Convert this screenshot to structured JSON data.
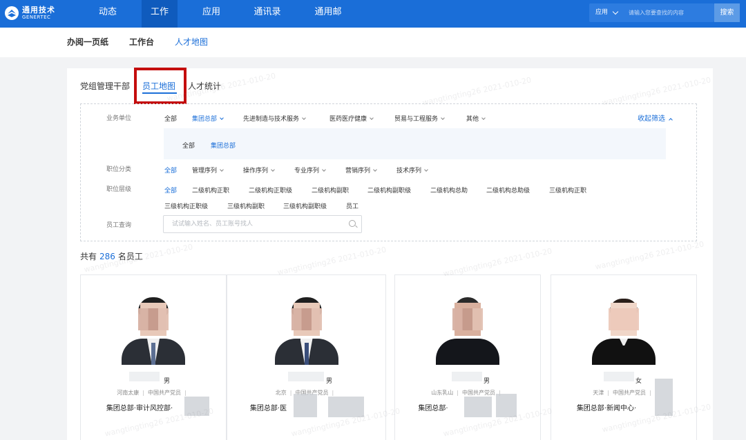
{
  "app": {
    "logo_cn": "通用技术",
    "logo_en": "GENERTEC"
  },
  "topnav": {
    "items": [
      "动态",
      "工作",
      "应用",
      "通讯录",
      "通用邮"
    ],
    "active": "工作",
    "search_scope": "应用",
    "search_placeholder": "请输入您要查找的内容",
    "search_button": "搜索"
  },
  "subnav": {
    "items": [
      "办阅一页纸",
      "工作台",
      "人才地图"
    ],
    "active": "人才地图"
  },
  "tabs": {
    "items": [
      "党组管理干部",
      "员工地图",
      "人才统计"
    ],
    "active": "员工地图"
  },
  "filters": {
    "unit": {
      "label": "业务单位",
      "options": [
        "全部",
        "集团总部",
        "先进制造与技术服务",
        "医药医疗健康",
        "贸易与工程服务",
        "其他"
      ],
      "collapse_label": "收起筛选",
      "sub_options": [
        "全部",
        "集团总部"
      ]
    },
    "category": {
      "label": "职位分类",
      "options": [
        "全部",
        "管理序列",
        "操作序列",
        "专业序列",
        "营销序列",
        "技术序列"
      ]
    },
    "level": {
      "label": "职位层级",
      "options_row1": [
        "全部",
        "二级机构正职",
        "二级机构正职级",
        "二级机构副职",
        "二级机构副职级",
        "二级机构总助",
        "二级机构总助级",
        "三级机构正职"
      ],
      "options_row2": [
        "三级机构正职级",
        "三级机构副职",
        "三级机构副职级",
        "员工"
      ]
    },
    "employee_search": {
      "label": "员工查询",
      "placeholder": "试试输入姓名、员工账号找人"
    }
  },
  "summary": {
    "prefix": "共有",
    "count": "286",
    "suffix": "名员工"
  },
  "employees": [
    {
      "gender": "男",
      "origin": "河南太康",
      "party": "中国共产党员",
      "dept": "集团总部·审计风控部·"
    },
    {
      "gender": "男",
      "origin": "北京",
      "party": "中国共产党员",
      "dept": "集团总部·医"
    },
    {
      "gender": "男",
      "origin": "山东乳山",
      "party": "中国共产党员",
      "dept": "集团总部·"
    },
    {
      "gender": "女",
      "origin": "天津",
      "party": "中国共产党员",
      "dept": "集团总部·新闻中心·"
    }
  ],
  "watermark": "wangtingting26 2021-010-20",
  "colors": {
    "brand": "#1a6ed8",
    "highlight": "#c40d0d"
  }
}
